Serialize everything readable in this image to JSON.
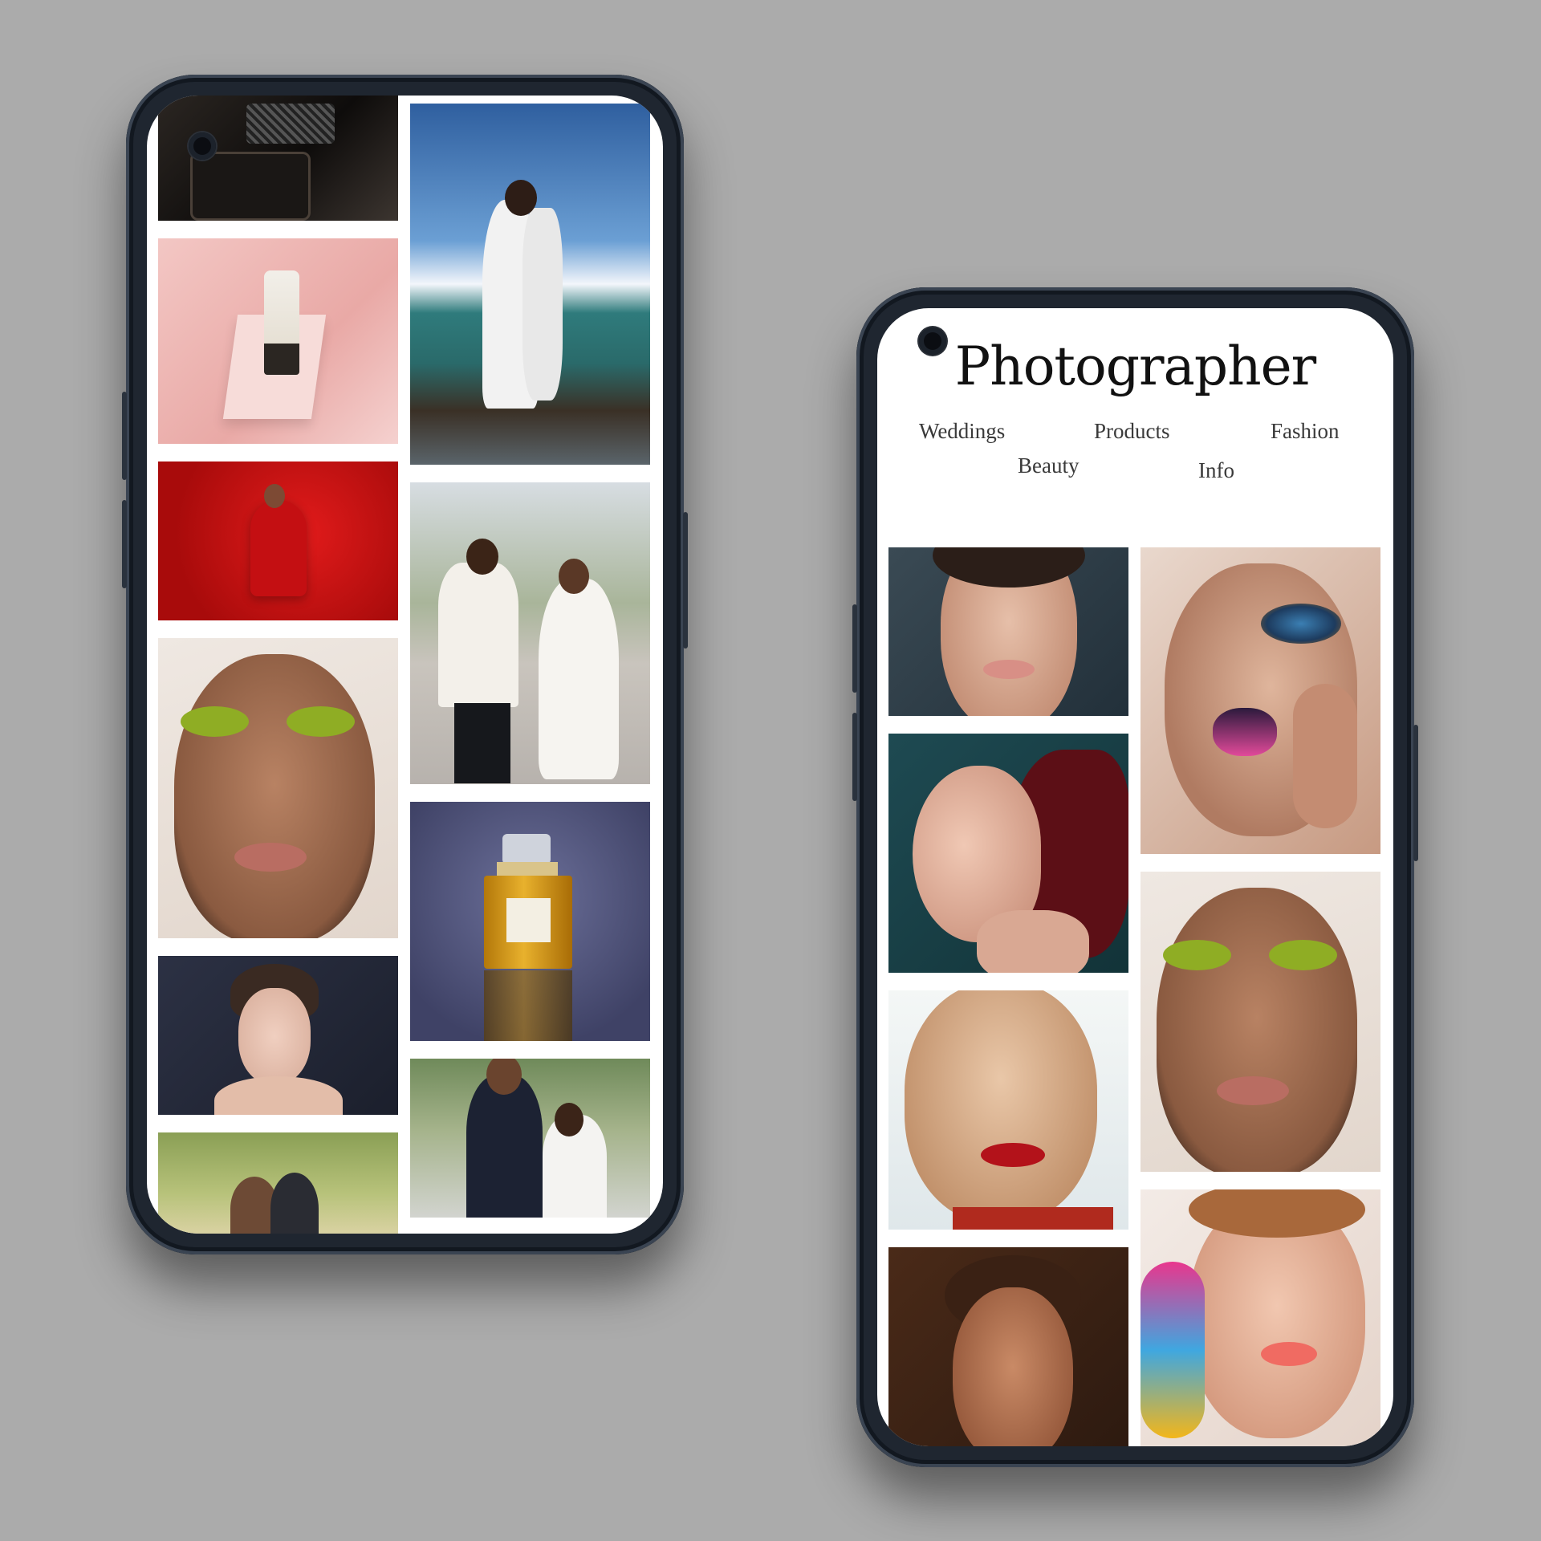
{
  "colors": {
    "background": "#ababab",
    "phone_frame": "#1f2630",
    "screen": "#ffffff"
  },
  "left_phone": {
    "camera": "front-camera-icon",
    "gallery": [
      {
        "label": ""
      },
      {
        "label": ""
      },
      {
        "label": ""
      },
      {
        "label": ""
      },
      {
        "label": ""
      },
      {
        "label": ""
      },
      {
        "label": ""
      },
      {
        "label": ""
      },
      {
        "label": ""
      },
      {
        "label": ""
      },
      {
        "label": ""
      },
      {
        "label": ""
      }
    ]
  },
  "right_phone": {
    "camera": "front-camera-icon",
    "site_title": "Photographer",
    "nav": {
      "weddings": "Weddings",
      "products": "Products",
      "fashion": "Fashion",
      "beauty": "Beauty",
      "info": "Info"
    }
  }
}
